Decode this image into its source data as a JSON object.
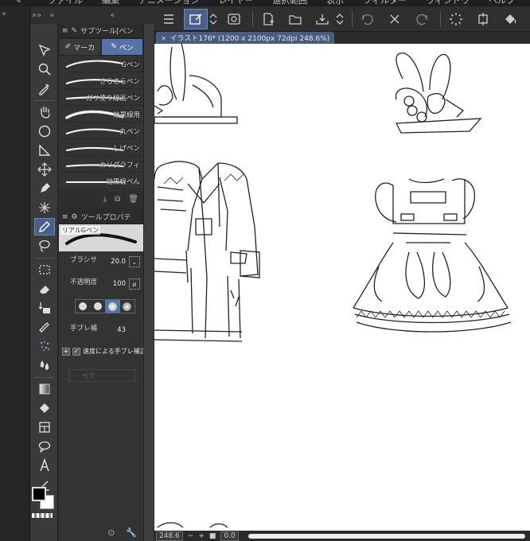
{
  "menu": [
    "ファイル",
    "編集",
    "アニメーション",
    "レイヤー",
    "選択範囲",
    "表示",
    "フィルター",
    "ウィンドウ",
    "ヘルプ"
  ],
  "sub_tool": {
    "title": "サブツール[ペン",
    "tabs": [
      {
        "label": "マーカ",
        "selected": false
      },
      {
        "label": "ペン",
        "selected": true
      }
    ],
    "brushes": [
      {
        "label": "Gペン",
        "selected": false
      },
      {
        "label": "さらさらペン",
        "selected": false
      },
      {
        "label": "ガサ塗り線画ペン",
        "selected": false
      },
      {
        "label": "効果線用",
        "selected": false
      },
      {
        "label": "丸ペン",
        "selected": false
      },
      {
        "label": "しげペン",
        "selected": false
      },
      {
        "label": "カリグラフィ",
        "selected": false
      },
      {
        "label": "効果線ペん",
        "selected": false
      }
    ]
  },
  "tool_property": {
    "title": "ツールプロパテ",
    "brush_name": "リアルGペン",
    "brush_size_label": "ブラシサ",
    "brush_size": "20.0",
    "opacity_label": "不透明度",
    "opacity": "100",
    "stabilization_label": "手ブレ補",
    "stabilization": "43",
    "speed_correction_label": "速度による手ブレ補正",
    "speed_correction_checked": true,
    "vector_label": "ベク"
  },
  "canvas": {
    "tab_label": "イラスト176* (1200 x 2100px 72dpi 248.6%)"
  },
  "status": {
    "zoom": "248.6",
    "angle": "0.0"
  },
  "colors": {
    "accent": "#5573a9",
    "foreground": "#000000",
    "background": "#ffffff"
  }
}
